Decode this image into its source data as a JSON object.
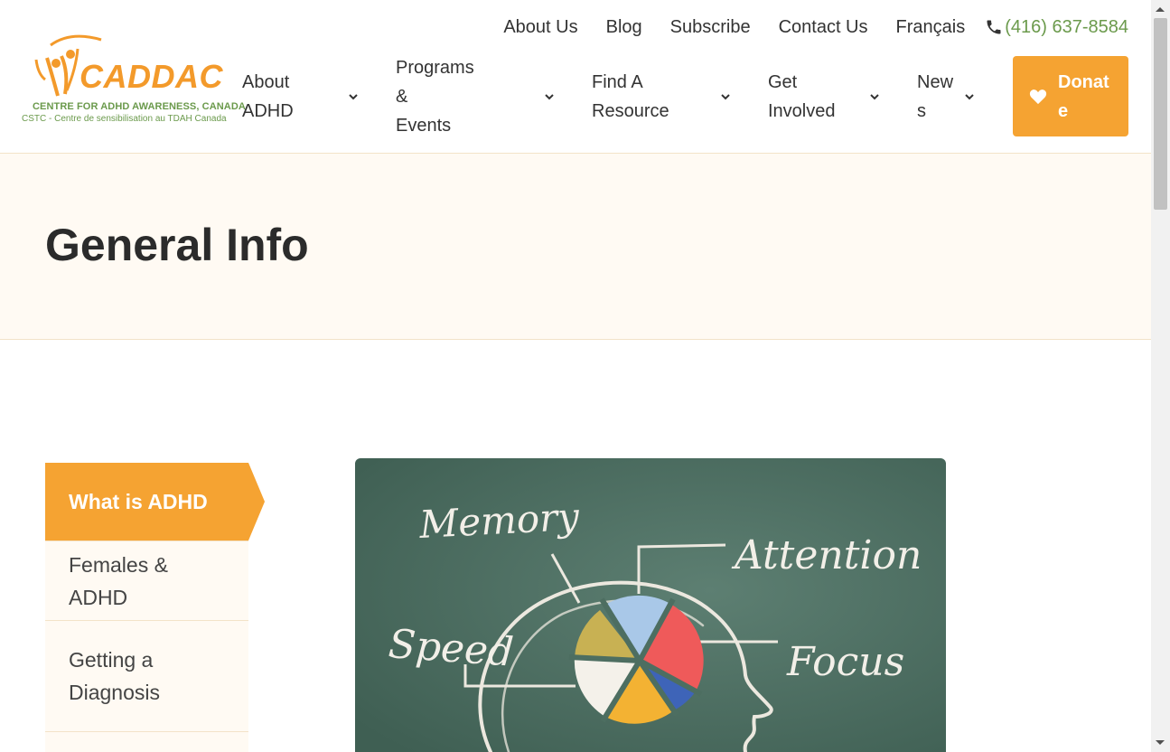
{
  "brand": {
    "name": "CADDAC",
    "tagline": "CENTRE FOR ADHD AWARENESS, CANADA",
    "tagline_fr": "CSTC - Centre de sensibilisation au TDAH Canada",
    "primary_color": "#f5a332",
    "accent_color": "#6b9a4c"
  },
  "utility_nav": {
    "items": [
      {
        "label": "About Us"
      },
      {
        "label": "Blog"
      },
      {
        "label": "Subscribe"
      },
      {
        "label": "Contact Us"
      },
      {
        "label": "Français"
      }
    ],
    "phone": "(416) 637-8584"
  },
  "main_nav": {
    "items": [
      {
        "line1": "About",
        "line2": "ADHD"
      },
      {
        "line1": "Programs &",
        "line2": "Events"
      },
      {
        "line1": "Find A",
        "line2": "Resource"
      },
      {
        "line1": "Get",
        "line2": "Involved"
      },
      {
        "line1": "New",
        "line2": "s"
      }
    ],
    "donate_label": "Donate"
  },
  "page": {
    "title": "General Info"
  },
  "sidebar": {
    "items": [
      {
        "label": "What is ADHD",
        "active": true
      },
      {
        "label": "Females & ADHD",
        "active": false
      },
      {
        "label": "Getting a Diagnosis",
        "active": false
      },
      {
        "label": "",
        "active": false
      }
    ]
  },
  "image": {
    "chalk_words": {
      "memory": "Memory",
      "attention": "Attention",
      "speed": "Speed",
      "focus": "Focus"
    },
    "board_color": "#4d6e61",
    "pie_colors": [
      "#a9c8e8",
      "#ef5a5a",
      "#3e64b8",
      "#f3b233",
      "#f4f1ea",
      "#c8b153"
    ]
  }
}
